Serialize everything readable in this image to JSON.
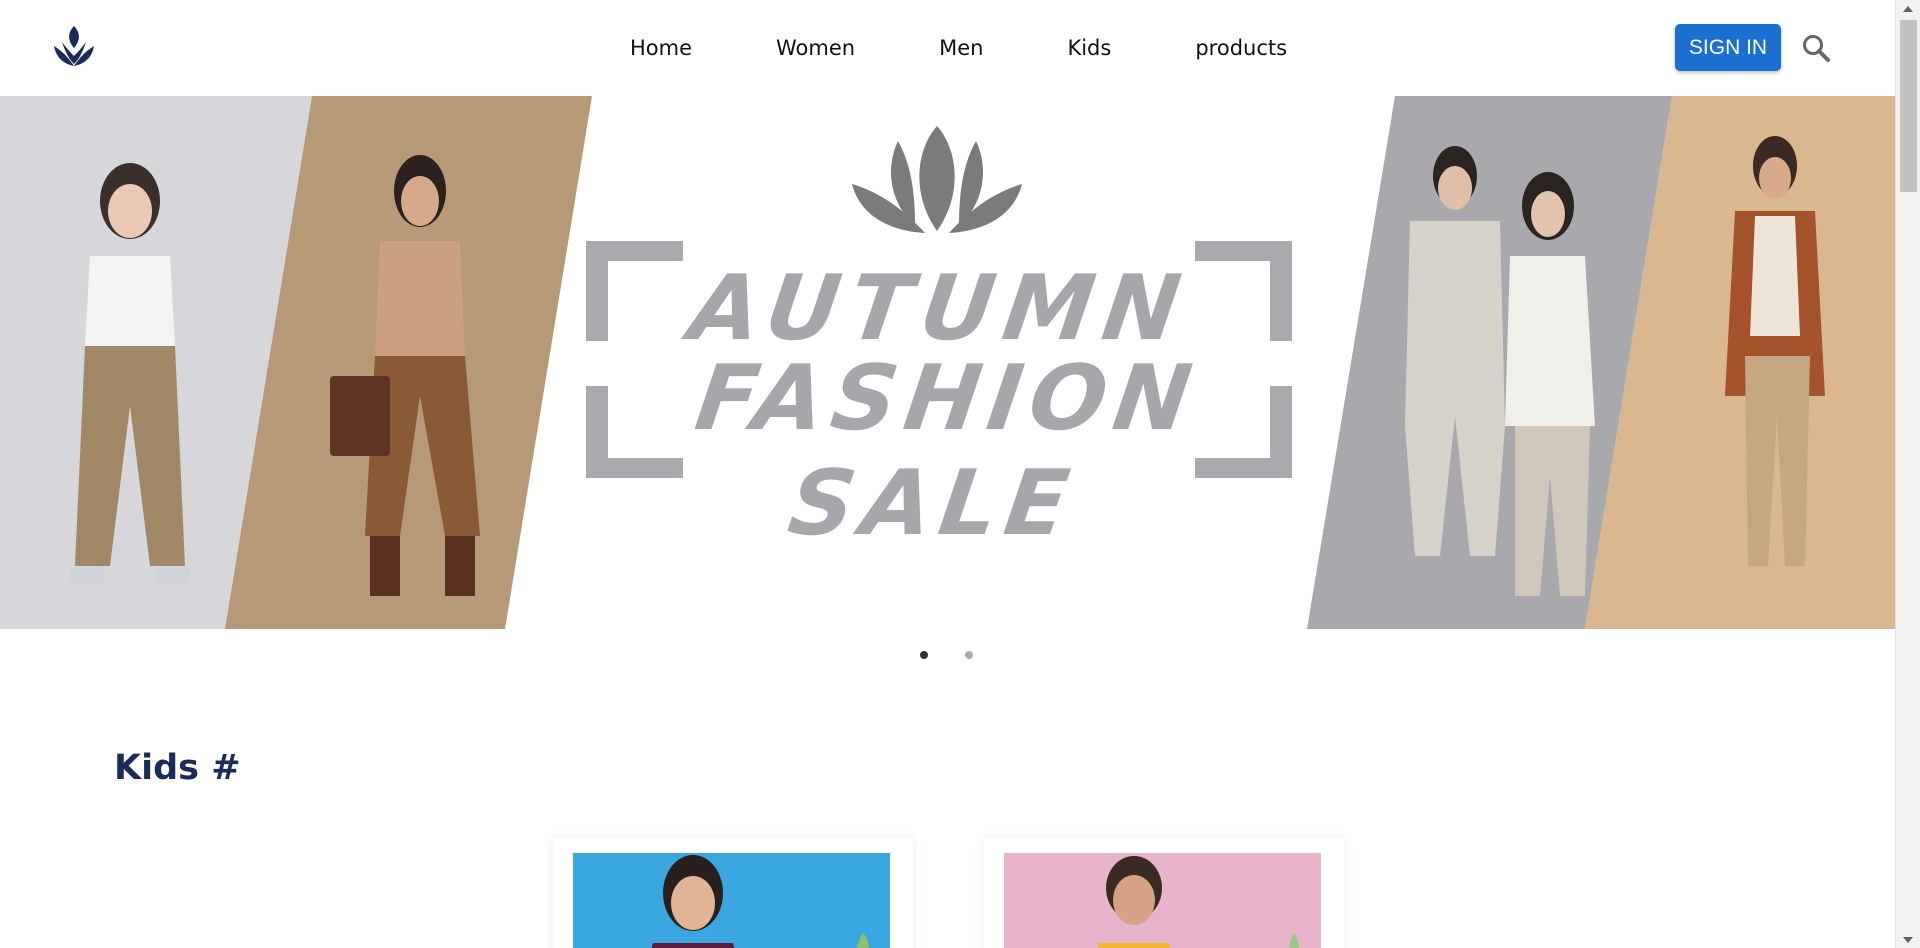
{
  "header": {
    "logo_icon": "lotus-logo-icon",
    "nav": [
      {
        "label": "Home"
      },
      {
        "label": "Women"
      },
      {
        "label": "Men"
      },
      {
        "label": "Kids"
      },
      {
        "label": "products"
      }
    ],
    "signin_label": "SIGN IN",
    "search_icon": "search-icon"
  },
  "hero": {
    "line1": "AUTUMN",
    "line2": "FASHION SALE",
    "emblem_icon": "lotus-icon",
    "slides": 2,
    "active_slide": 1
  },
  "kids_section": {
    "title": "Kids #",
    "cards": [
      {
        "image": "girl-in-purple-outfit-photo",
        "background": "#3aa7e0"
      },
      {
        "image": "boy-in-yellow-outfit-photo",
        "background": "#e8b4cc"
      }
    ]
  },
  "colors": {
    "brand_navy": "#1c2b5a",
    "signin_blue": "#1a6fd0",
    "sale_text_gray": "#a7a7ab"
  }
}
